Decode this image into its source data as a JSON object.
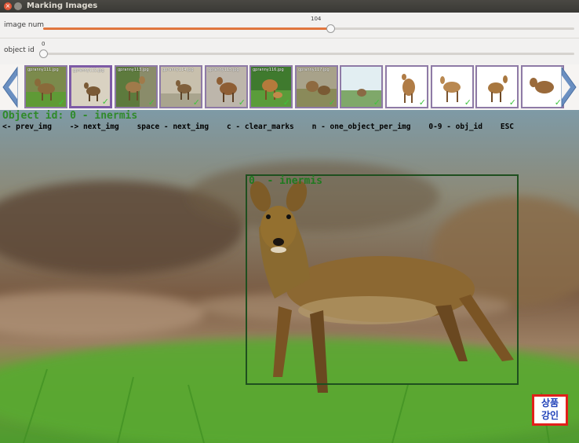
{
  "window": {
    "title": "Marking Images",
    "close_glyph": "×"
  },
  "sliders": {
    "image_num": {
      "label": "image num",
      "value": "104",
      "level": 0.54
    },
    "object_id": {
      "label": "object id",
      "value": "0",
      "level": 0.0
    }
  },
  "thumbnails": [
    {
      "filename": "gpranny111.jpg",
      "checked": true,
      "current": false
    },
    {
      "filename": "gpranny112.jpg",
      "checked": true,
      "current": true
    },
    {
      "filename": "gpranny113.jpg",
      "checked": true,
      "current": false
    },
    {
      "filename": "gpranny114.jpg",
      "checked": true,
      "current": false
    },
    {
      "filename": "gpranny115.jpg",
      "checked": true,
      "current": false
    },
    {
      "filename": "gpranny116.jpg",
      "checked": true,
      "current": false
    },
    {
      "filename": "gpranny117.jpg",
      "checked": true,
      "current": false
    },
    {
      "filename": "",
      "checked": true,
      "current": false
    },
    {
      "filename": "",
      "checked": true,
      "current": false
    },
    {
      "filename": "",
      "checked": true,
      "current": false
    },
    {
      "filename": "",
      "checked": true,
      "current": false
    },
    {
      "filename": "",
      "checked": true,
      "current": false
    }
  ],
  "overlay": {
    "object_line": "Object id: 0    - inermis",
    "help_line": "<- prev_img    -> next_img    space - next_img    c - clear_marks    n - one_object_per_img    0-9 - obj_id    ESC",
    "bbox_label": "0  - inermis"
  },
  "seal": {
    "line1": "상품",
    "line2": "강인"
  },
  "icons": {
    "prev": "left-triangle-icon",
    "next": "right-triangle-icon",
    "check": "checkmark-icon"
  },
  "colors": {
    "accent": "#e0763e",
    "thumb_border": "#8e7aa6",
    "arrow": "#6a8fc1",
    "overlay_green": "#2f8a2a",
    "bbox": "#1f4f1f",
    "seal_red": "#e1201a",
    "seal_blue": "#1d3fb8"
  }
}
